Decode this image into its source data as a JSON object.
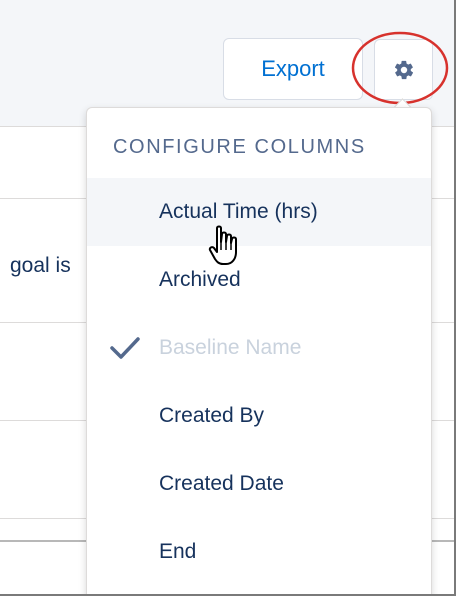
{
  "toolbar": {
    "export_label": "Export",
    "settings_icon": "gear-icon"
  },
  "table": {
    "visible_cell_text": "goal is"
  },
  "menu": {
    "header": "CONFIGURE COLUMNS",
    "items": [
      {
        "label": "Actual Time (hrs)",
        "state": "hover",
        "checked": false
      },
      {
        "label": "Archived",
        "state": "normal",
        "checked": false
      },
      {
        "label": "Baseline Name",
        "state": "disabled",
        "checked": true
      },
      {
        "label": "Created By",
        "state": "normal",
        "checked": false
      },
      {
        "label": "Created Date",
        "state": "normal",
        "checked": false
      },
      {
        "label": "End",
        "state": "normal",
        "checked": false
      }
    ]
  },
  "colors": {
    "brand_blue": "#0070d2",
    "text_navy": "#16325c",
    "header_gray": "#54698d",
    "disabled_text": "#c9d2dd",
    "highlight_ring": "#d7322d",
    "hover_bg": "#f4f6f9"
  },
  "icons": {
    "checkmark": "check-icon",
    "pointer": "hand-pointer-cursor-icon"
  }
}
